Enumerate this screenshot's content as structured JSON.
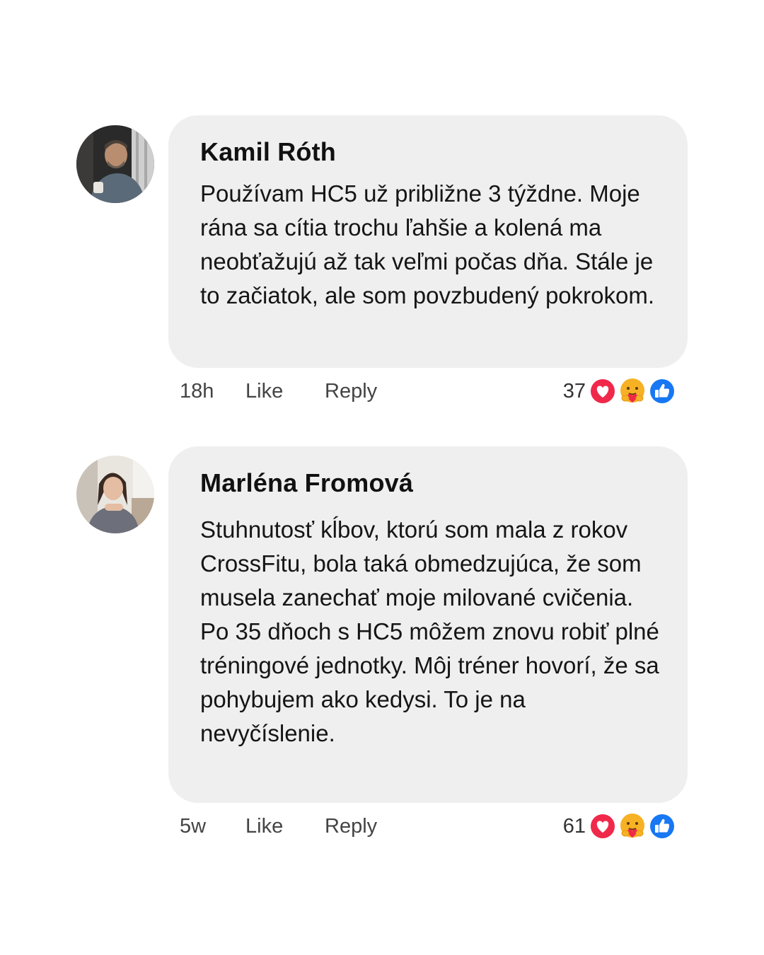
{
  "comments": [
    {
      "author": "Kamil Róth",
      "text": "Používam HC5 už približne 3 týždne. Moje rána sa cítia trochu ľahšie a kolená ma neobťažujú až tak veľmi počas dňa. Stále je to začiatok, ale som povzbudený pokrokom.",
      "time": "18h",
      "like_label": "Like",
      "reply_label": "Reply",
      "reaction_count": "37",
      "reactions": [
        "heart-icon",
        "care-icon",
        "thumbs-up-icon"
      ]
    },
    {
      "author": "Marléna Fromová",
      "text": "Stuhnutosť kĺbov, ktorú som mala z rokov CrossFitu, bola taká obmedzujúca, že som musela zanechať moje milované cvičenia. Po 35 dňoch s HC5 môžem znovu robiť plné tréningové jednotky. Môj tréner hovorí, že sa pohybujem ako kedysi. To je na nevyčíslenie.",
      "time": "5w",
      "like_label": "Like",
      "reply_label": "Reply",
      "reaction_count": "61",
      "reactions": [
        "heart-icon",
        "care-icon",
        "thumbs-up-icon"
      ]
    }
  ],
  "colors": {
    "bubble": "#efefef",
    "heart": "#f0284a",
    "care": "#f7b125",
    "like": "#1877f2"
  }
}
